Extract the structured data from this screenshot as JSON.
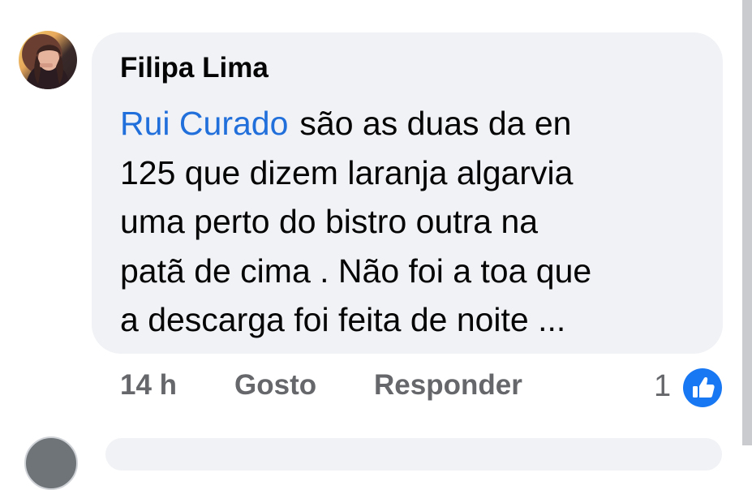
{
  "comment": {
    "author": "Filipa Lima",
    "mention": "Rui Curado",
    "lines": [
      "são as duas da en",
      "125 que dizem laranja algarvia",
      "uma perto do bistro outra na",
      "patã de cima . Não foi a toa que",
      "a descarga foi feita de noite ..."
    ],
    "time": "14 h",
    "like_label": "Gosto",
    "reply_label": "Responder",
    "reaction_count": "1",
    "reaction_icon": "thumbs-up-icon"
  },
  "colors": {
    "mention": "#216fdb",
    "bubble": "#f0f2f5",
    "meta": "#65676b",
    "like_badge": "#1877f2"
  }
}
